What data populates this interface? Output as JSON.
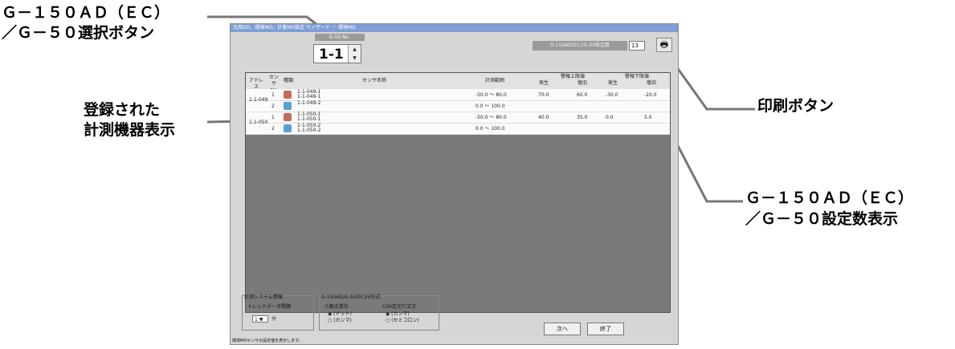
{
  "annotations": {
    "top_left_1": "Ｇ－１５０ＡＤ（ＥＣ）",
    "top_left_2": "／Ｇ－５０選択ボタン",
    "left_mid_1": "登録された",
    "left_mid_2": "計測機器表示",
    "right_print": "印刷ボタン",
    "right_bottom_1": "Ｇ－１５０ＡＤ（ＥＣ）",
    "right_bottom_2": "／Ｇ－５０設定数表示"
  },
  "window": {
    "title": "汎用DO、環境MO、計量MO設定 ウィザード － 環境MO",
    "g50_label": "G-50 No.",
    "g50_value": "1-1",
    "count_label": "G-150AD(EC)/G-50設定数",
    "count_value": "13",
    "print_icon": "printer-icon"
  },
  "table": {
    "headers": {
      "address": "アドレス",
      "sensor_no": "センサ No",
      "kind": "種類",
      "sensor_name": "センサ名称",
      "range": "計測範囲",
      "upper": "警報上限値",
      "lower": "警報下限値",
      "occur": "発生",
      "recover": "復旧",
      "occur2": "発生",
      "recover2": "復旧"
    },
    "rows": [
      {
        "address": "1-1-049",
        "no": "1",
        "name1": "1-1-049-1",
        "name2": "1-1-049-1",
        "range": "-50.0 ～ 80.0",
        "up_occ": "70.0",
        "up_rec": "60.0",
        "lo_occ": "-30.0",
        "lo_rec": "-20.0",
        "kind": "thermo"
      },
      {
        "address": "",
        "no": "2",
        "name1": "1-1-049-2",
        "name2": "",
        "range": "0.0 ～ 100.0",
        "up_occ": "",
        "up_rec": "",
        "lo_occ": "",
        "lo_rec": "",
        "kind": "humid"
      },
      {
        "address": "1-1-050",
        "no": "1",
        "name1": "1-1-050-1",
        "name2": "1-1-050-1",
        "range": "-50.0 ～ 80.0",
        "up_occ": "40.0",
        "up_rec": "35.0",
        "lo_occ": "0.0",
        "lo_rec": "5.0",
        "kind": "thermo"
      },
      {
        "address": "",
        "no": "2",
        "name1": "1-1-050-2",
        "name2": "1-1-050-2",
        "range": "0.0 ～ 100.0",
        "up_occ": "",
        "up_rec": "",
        "lo_occ": "",
        "lo_rec": "",
        "kind": "humid"
      }
    ]
  },
  "bottom": {
    "measure_title": "計測システム情報",
    "trend_label": "トレンドデータ間隔",
    "trend_value": "1",
    "trend_unit": "分",
    "csv_title": "G-150AD/G-50のCSV形式",
    "decimal_title": "小数点単位",
    "decimal_opt1": "(ドット)",
    "decimal_opt2": "(カンマ)",
    "sep_title": "CSV区切り文字",
    "sep_opt1": "(カンマ)",
    "sep_opt2": "(セミコロン)",
    "next": "次へ",
    "end": "終了",
    "status": "環境MOセンサの設定値を表示します。"
  }
}
